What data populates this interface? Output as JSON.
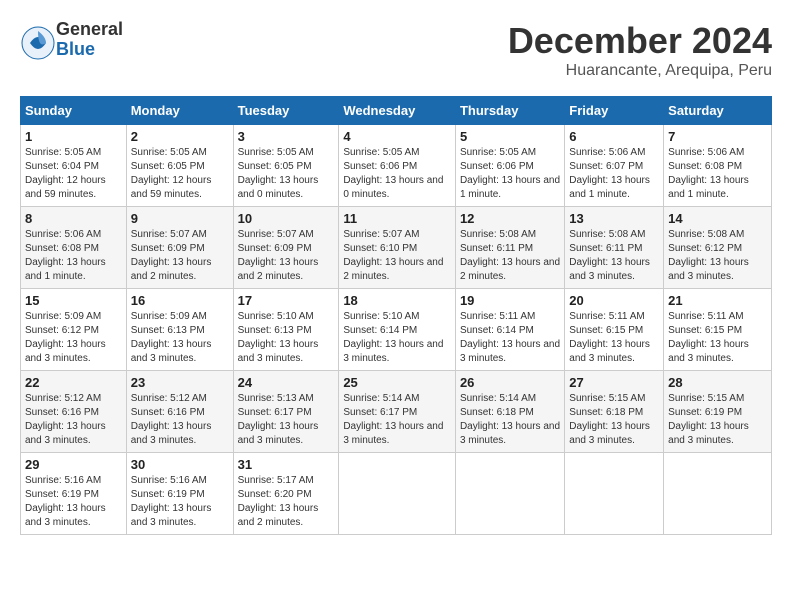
{
  "logo": {
    "general": "General",
    "blue": "Blue"
  },
  "title": "December 2024",
  "subtitle": "Huarancante, Arequipa, Peru",
  "days_of_week": [
    "Sunday",
    "Monday",
    "Tuesday",
    "Wednesday",
    "Thursday",
    "Friday",
    "Saturday"
  ],
  "weeks": [
    [
      {
        "day": "1",
        "sunrise": "5:05 AM",
        "sunset": "6:04 PM",
        "daylight": "12 hours and 59 minutes."
      },
      {
        "day": "2",
        "sunrise": "5:05 AM",
        "sunset": "6:05 PM",
        "daylight": "12 hours and 59 minutes."
      },
      {
        "day": "3",
        "sunrise": "5:05 AM",
        "sunset": "6:05 PM",
        "daylight": "13 hours and 0 minutes."
      },
      {
        "day": "4",
        "sunrise": "5:05 AM",
        "sunset": "6:06 PM",
        "daylight": "13 hours and 0 minutes."
      },
      {
        "day": "5",
        "sunrise": "5:05 AM",
        "sunset": "6:06 PM",
        "daylight": "13 hours and 1 minute."
      },
      {
        "day": "6",
        "sunrise": "5:06 AM",
        "sunset": "6:07 PM",
        "daylight": "13 hours and 1 minute."
      },
      {
        "day": "7",
        "sunrise": "5:06 AM",
        "sunset": "6:08 PM",
        "daylight": "13 hours and 1 minute."
      }
    ],
    [
      {
        "day": "8",
        "sunrise": "5:06 AM",
        "sunset": "6:08 PM",
        "daylight": "13 hours and 1 minute."
      },
      {
        "day": "9",
        "sunrise": "5:07 AM",
        "sunset": "6:09 PM",
        "daylight": "13 hours and 2 minutes."
      },
      {
        "day": "10",
        "sunrise": "5:07 AM",
        "sunset": "6:09 PM",
        "daylight": "13 hours and 2 minutes."
      },
      {
        "day": "11",
        "sunrise": "5:07 AM",
        "sunset": "6:10 PM",
        "daylight": "13 hours and 2 minutes."
      },
      {
        "day": "12",
        "sunrise": "5:08 AM",
        "sunset": "6:11 PM",
        "daylight": "13 hours and 2 minutes."
      },
      {
        "day": "13",
        "sunrise": "5:08 AM",
        "sunset": "6:11 PM",
        "daylight": "13 hours and 3 minutes."
      },
      {
        "day": "14",
        "sunrise": "5:08 AM",
        "sunset": "6:12 PM",
        "daylight": "13 hours and 3 minutes."
      }
    ],
    [
      {
        "day": "15",
        "sunrise": "5:09 AM",
        "sunset": "6:12 PM",
        "daylight": "13 hours and 3 minutes."
      },
      {
        "day": "16",
        "sunrise": "5:09 AM",
        "sunset": "6:13 PM",
        "daylight": "13 hours and 3 minutes."
      },
      {
        "day": "17",
        "sunrise": "5:10 AM",
        "sunset": "6:13 PM",
        "daylight": "13 hours and 3 minutes."
      },
      {
        "day": "18",
        "sunrise": "5:10 AM",
        "sunset": "6:14 PM",
        "daylight": "13 hours and 3 minutes."
      },
      {
        "day": "19",
        "sunrise": "5:11 AM",
        "sunset": "6:14 PM",
        "daylight": "13 hours and 3 minutes."
      },
      {
        "day": "20",
        "sunrise": "5:11 AM",
        "sunset": "6:15 PM",
        "daylight": "13 hours and 3 minutes."
      },
      {
        "day": "21",
        "sunrise": "5:11 AM",
        "sunset": "6:15 PM",
        "daylight": "13 hours and 3 minutes."
      }
    ],
    [
      {
        "day": "22",
        "sunrise": "5:12 AM",
        "sunset": "6:16 PM",
        "daylight": "13 hours and 3 minutes."
      },
      {
        "day": "23",
        "sunrise": "5:12 AM",
        "sunset": "6:16 PM",
        "daylight": "13 hours and 3 minutes."
      },
      {
        "day": "24",
        "sunrise": "5:13 AM",
        "sunset": "6:17 PM",
        "daylight": "13 hours and 3 minutes."
      },
      {
        "day": "25",
        "sunrise": "5:14 AM",
        "sunset": "6:17 PM",
        "daylight": "13 hours and 3 minutes."
      },
      {
        "day": "26",
        "sunrise": "5:14 AM",
        "sunset": "6:18 PM",
        "daylight": "13 hours and 3 minutes."
      },
      {
        "day": "27",
        "sunrise": "5:15 AM",
        "sunset": "6:18 PM",
        "daylight": "13 hours and 3 minutes."
      },
      {
        "day": "28",
        "sunrise": "5:15 AM",
        "sunset": "6:19 PM",
        "daylight": "13 hours and 3 minutes."
      }
    ],
    [
      {
        "day": "29",
        "sunrise": "5:16 AM",
        "sunset": "6:19 PM",
        "daylight": "13 hours and 3 minutes."
      },
      {
        "day": "30",
        "sunrise": "5:16 AM",
        "sunset": "6:19 PM",
        "daylight": "13 hours and 3 minutes."
      },
      {
        "day": "31",
        "sunrise": "5:17 AM",
        "sunset": "6:20 PM",
        "daylight": "13 hours and 2 minutes."
      },
      null,
      null,
      null,
      null
    ]
  ]
}
